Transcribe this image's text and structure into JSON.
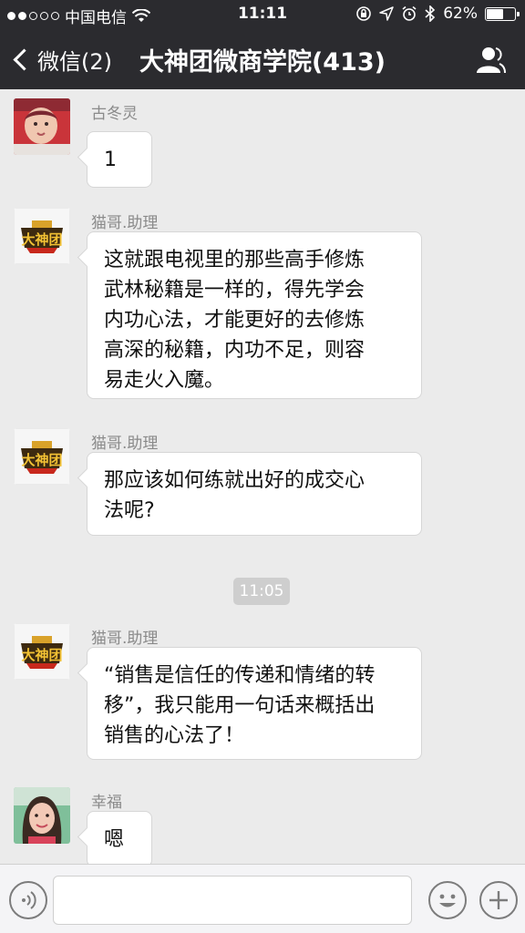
{
  "status_bar": {
    "carrier": "中国电信",
    "time": "11:11",
    "battery": "62%",
    "battery_level": 0.62
  },
  "nav": {
    "back_label": "微信(2)",
    "title": "大神团微商学院(413)"
  },
  "messages": [
    {
      "sender": "古冬灵",
      "text": "1",
      "avatar": "baby-photo"
    },
    {
      "sender": "猫哥.助理",
      "text": "这就跟电视里的那些高手修炼\n武林秘籍是一样的，得先学会\n内功心法，才能更好的去修炼\n高深的秘籍，内功不足，则容\n易走火入魔。",
      "avatar": "dashentuan-logo"
    },
    {
      "sender": "猫哥.助理",
      "text": "那应该如何练就出好的成交心\n法呢?",
      "avatar": "dashentuan-logo"
    },
    {
      "sender": "猫哥.助理",
      "text": "“销售是信任的传递和情绪的转\n移”，我只能用一句话来概括出\n销售的心法了！",
      "avatar": "dashentuan-logo"
    },
    {
      "sender": "幸福",
      "text": "嗯",
      "avatar": "woman-photo"
    }
  ],
  "timestamp": "11:05",
  "logo": {
    "text": "大神团",
    "colors": {
      "gold": "#f3c234",
      "red": "#c8281c"
    }
  },
  "input_bar": {
    "icons": [
      "voice-icon",
      "emoji-icon",
      "plus-icon"
    ]
  }
}
